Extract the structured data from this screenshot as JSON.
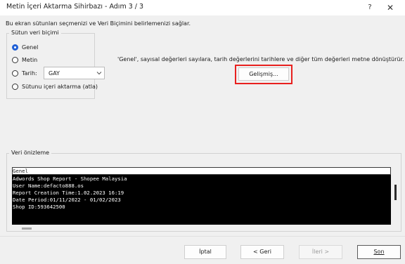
{
  "window": {
    "title": "Metin İçeri Aktarma Sihirbazı - Adım 3 / 3",
    "help_label": "?",
    "close_label": "✕"
  },
  "intro": "Bu ekran sütunları seçmenizi ve Veri Biçimini belirlemenizi  sağlar.",
  "column_format": {
    "legend": "Sütun veri biçimi",
    "options": [
      {
        "label": "Genel",
        "checked": true
      },
      {
        "label": "Metin",
        "checked": false
      },
      {
        "label": "Tarih:",
        "checked": false
      },
      {
        "label": "Sütunu içeri aktarma (atla)",
        "checked": false
      }
    ],
    "date_format_value": "GAY"
  },
  "description": "'Genel', sayısal değerleri sayılara, tarih değerlerini tarihlere ve diğer tüm değerleri metne dönüştürür.",
  "advanced_button": "Gelişmiş...",
  "preview": {
    "legend": "Veri önizleme",
    "header": "Genel",
    "lines": [
      "Adwords Shop Report - Shopee Malaysia",
      "User Name:defacto888.os",
      "Report Creation Time:1.02.2023 16:19",
      "Date Period:01/11/2022 - 01/02/2023",
      "Shop ID:593642500"
    ]
  },
  "footer": {
    "cancel": "İptal",
    "back": "< Geri",
    "next": "İleri >",
    "finish": "Son"
  },
  "colors": {
    "accent": "#1f5fd6",
    "highlight": "#e8201e"
  }
}
